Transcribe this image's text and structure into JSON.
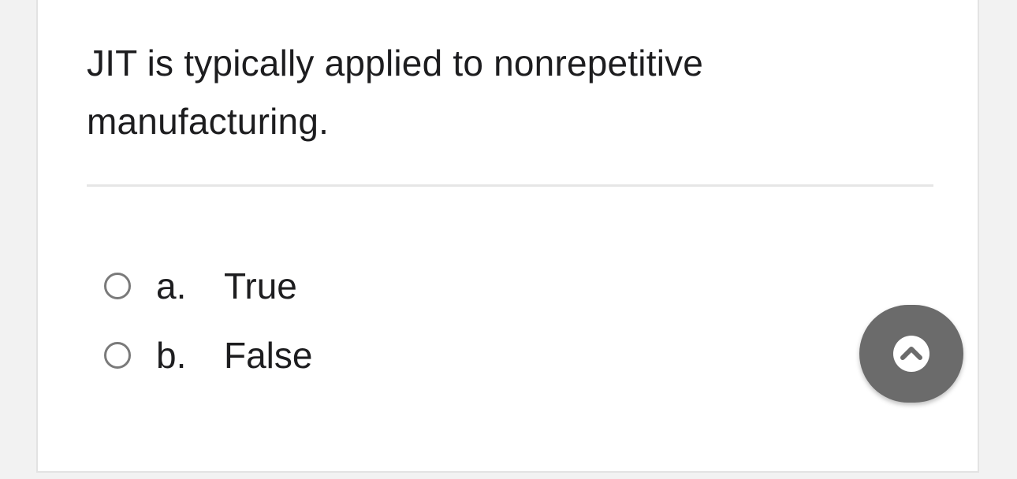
{
  "question": {
    "text": "JIT is typically applied to nonrepetitive manufacturing."
  },
  "options": [
    {
      "letter": "a.",
      "label": "True",
      "selected": false
    },
    {
      "letter": "b.",
      "label": "False",
      "selected": false
    }
  ],
  "fab": {
    "icon": "chevron-up-circle-icon"
  },
  "colors": {
    "page_background": "#f2f2f2",
    "card_background": "#ffffff",
    "text": "#1d1d1f",
    "radio_border": "#7a7a7a",
    "fab_background": "#6b6b6b"
  }
}
